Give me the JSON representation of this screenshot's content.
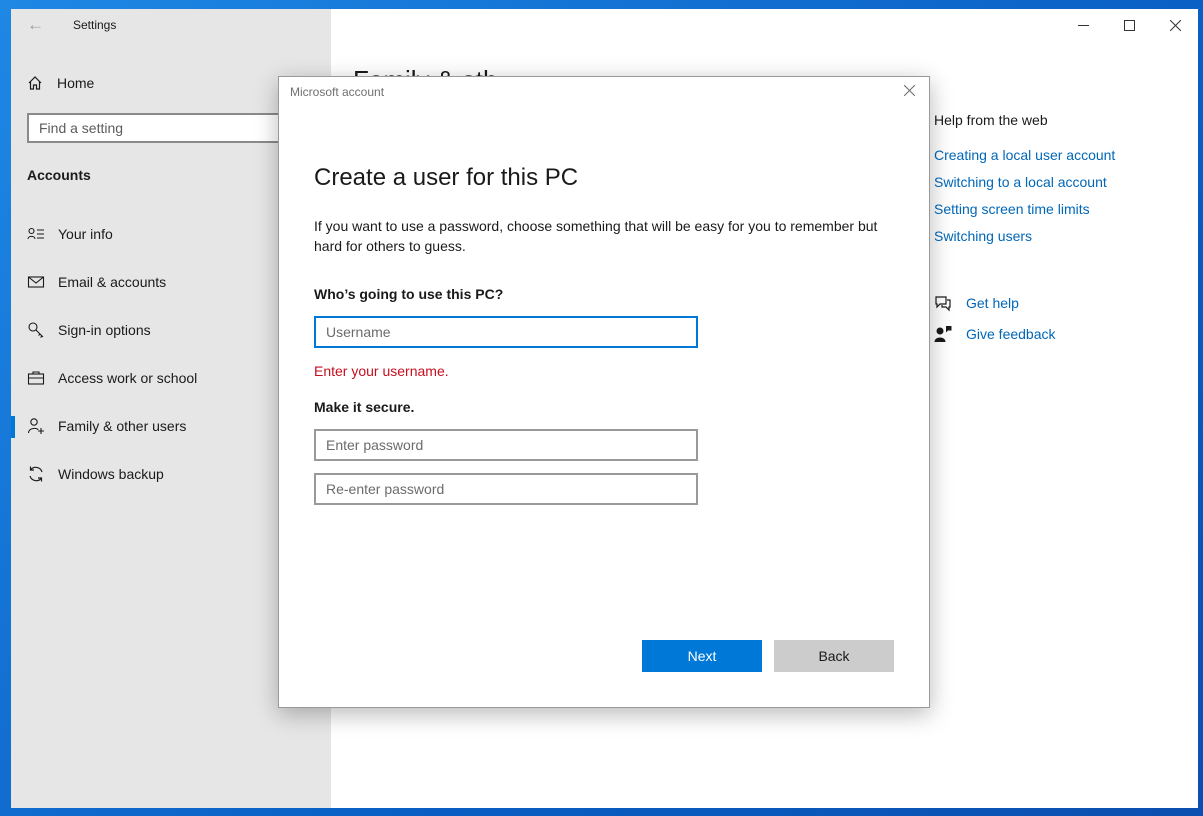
{
  "window": {
    "title": "Settings"
  },
  "sidebar": {
    "home_label": "Home",
    "search_placeholder": "Find a setting",
    "section_title": "Accounts",
    "items": [
      {
        "label": "Your info",
        "icon": "person-card-icon"
      },
      {
        "label": "Email & accounts",
        "icon": "mail-icon"
      },
      {
        "label": "Sign-in options",
        "icon": "key-icon"
      },
      {
        "label": "Access work or school",
        "icon": "briefcase-icon"
      },
      {
        "label": "Family & other users",
        "icon": "person-add-icon",
        "active": true
      },
      {
        "label": "Windows backup",
        "icon": "sync-icon"
      }
    ]
  },
  "main": {
    "title": "Family & oth",
    "help": {
      "title": "Help from the web",
      "links": [
        "Creating a local user account",
        "Switching to a local account",
        "Setting screen time limits",
        "Switching users"
      ]
    },
    "support": {
      "get_help": "Get help",
      "give_feedback": "Give feedback"
    }
  },
  "dialog": {
    "title": "Microsoft account",
    "heading": "Create a user for this PC",
    "description": "If you want to use a password, choose something that will be easy for you to remember but hard for others to guess.",
    "who_label": "Who’s going to use this PC?",
    "username_placeholder": "Username",
    "username_value": "",
    "error": "Enter your username.",
    "secure_label": "Make it secure.",
    "password_placeholder": "Enter password",
    "reenter_placeholder": "Re-enter password",
    "next_label": "Next",
    "back_label": "Back"
  },
  "colors": {
    "accent": "#0078d7",
    "link": "#0067b8",
    "error": "#c50f1f",
    "sidebar_bg": "#e6e6e6",
    "desktop": "#1478d4"
  }
}
